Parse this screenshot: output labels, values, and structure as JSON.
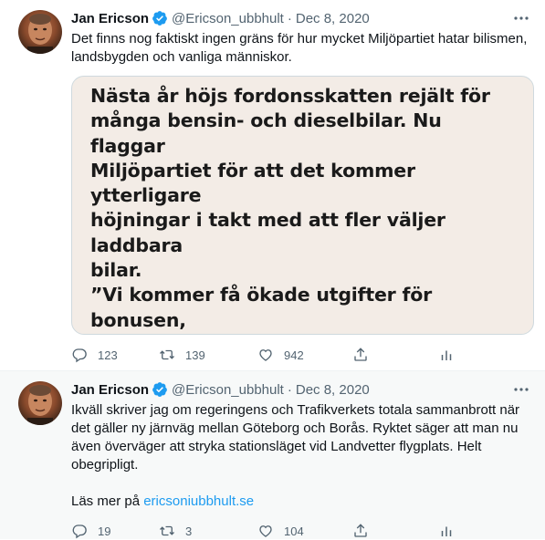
{
  "tweets": [
    {
      "author": "Jan Ericson",
      "handle": "@Ericson_ubbhult",
      "separator": "·",
      "date": "Dec 8, 2020",
      "text": "Det finns nog faktiskt ingen gräns för hur mycket Miljöpartiet hatar bilismen, landsbygden och vanliga människor.",
      "image_text": "Nästa år höjs fordonsskatten rejält för\nmånga bensin- och dieselbilar. Nu flaggar\nMiljöpartiet för att det kommer ytterligare\nhöjningar i takt med att fler väljer laddbara\nbilar.\n”Vi kommer få ökade utgifter för bonusen,\nvilket gör att vi kommer smalna av den och\nsamtidigt höja malusen. Det är så det\nfungerar”, säger Lorentz Tovatt (MP) som\nsitter i trafikutskottet.",
      "replies": "123",
      "retweets": "139",
      "likes": "942",
      "icons": {
        "reply": "reply-icon",
        "retweet": "retweet-icon",
        "like": "heart-icon",
        "share": "share-icon",
        "analytics": "analytics-icon",
        "verified": "verified-badge-icon",
        "more": "more-options-icon"
      }
    },
    {
      "author": "Jan Ericson",
      "handle": "@Ericson_ubbhult",
      "separator": "·",
      "date": "Dec 8, 2020",
      "text": "Ikväll skriver jag om regeringens och Trafikverkets totala sammanbrott när det gäller ny järnväg mellan Göteborg och Borås. Ryktet säger att man nu även överväger att stryka stationsläget vid Landvetter flygplats. Helt obegripligt.",
      "link_prefix": "Läs mer på ",
      "link_text": "ericsoniubbhult.se",
      "replies": "19",
      "retweets": "3",
      "likes": "104"
    }
  ],
  "colors": {
    "text": "#0f1419",
    "muted": "#536471",
    "link": "#1d9bf0",
    "verified": "#1d9bf0",
    "card_border": "#cfd9de",
    "image_bg": "#f3ece6",
    "second_bg": "#f7f9f9"
  }
}
